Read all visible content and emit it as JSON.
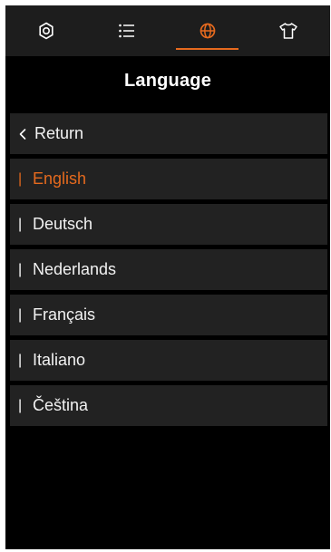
{
  "tabs": [
    {
      "icon": "settings-icon"
    },
    {
      "icon": "list-icon"
    },
    {
      "icon": "globe-icon",
      "active": true
    },
    {
      "icon": "shirt-icon"
    }
  ],
  "colors": {
    "accent": "#e66a1e",
    "background": "#000000",
    "row_background": "#222222",
    "tabbar_background": "#1d1d1d",
    "text": "#f2f2f2"
  },
  "page": {
    "title": "Language"
  },
  "return": {
    "label": "Return",
    "icon": "chevron-left-icon"
  },
  "languages": [
    {
      "label": "English",
      "selected": true
    },
    {
      "label": "Deutsch"
    },
    {
      "label": "Nederlands"
    },
    {
      "label": "Français"
    },
    {
      "label": "Italiano"
    },
    {
      "label": "Čeština"
    }
  ]
}
